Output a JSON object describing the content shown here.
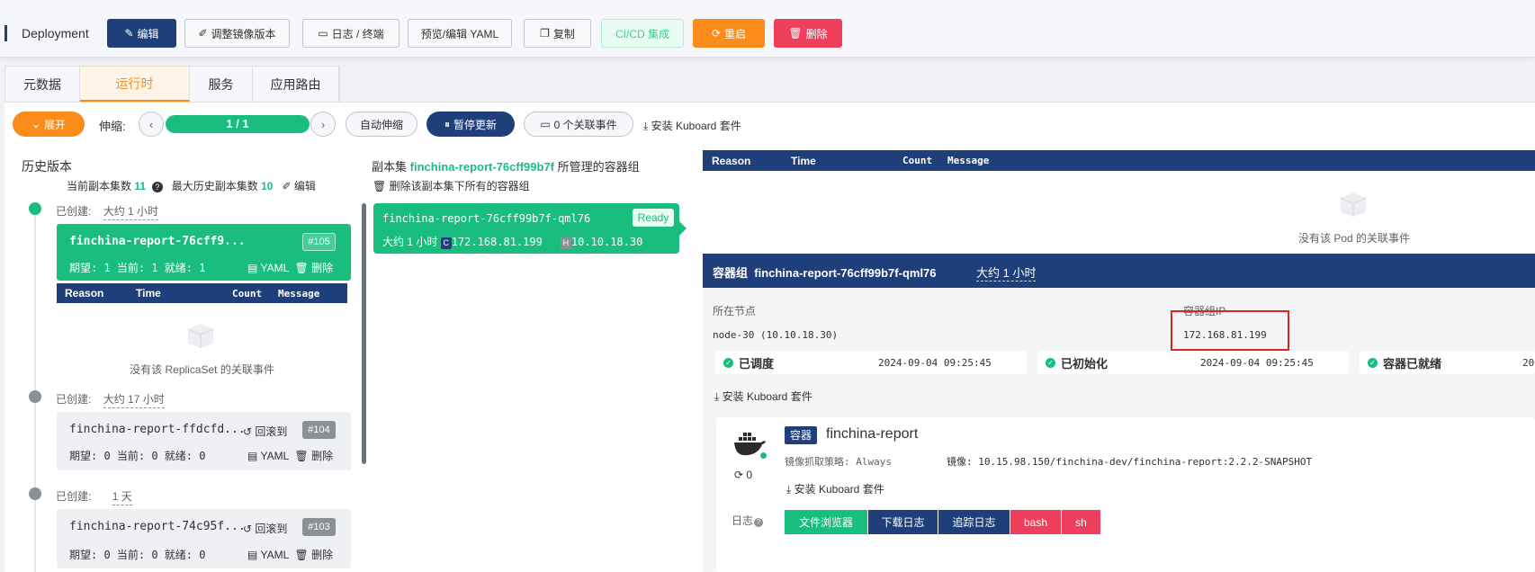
{
  "toolbar": {
    "kind": "Deployment",
    "buttons": {
      "edit": "编辑",
      "adjust_image": "调整镜像版本",
      "logs": "日志 / 终端",
      "yaml": "预览/编辑 YAML",
      "copy": "复制",
      "cicd": "CI/CD 集成",
      "restart": "重启",
      "delete": "删除"
    }
  },
  "tabs": [
    {
      "label": "元数据",
      "active": false
    },
    {
      "label": "运行时",
      "active": true
    },
    {
      "label": "服务",
      "active": false
    },
    {
      "label": "应用路由",
      "active": false
    }
  ],
  "controls": {
    "expand": "展开",
    "scale_label": "伸缩:",
    "scale_text": "1 / 1",
    "scale_fraction": 1.0,
    "autoscale": "自动伸缩",
    "pause_update": "暂停更新",
    "related_events": "0 个关联事件",
    "install_kuboard": "安装 Kuboard 套件"
  },
  "history": {
    "title": "历史版本",
    "current_label": "当前副本集数",
    "current_value": "11",
    "max_label": "最大历史副本集数",
    "max_value": "10",
    "edit": "编辑",
    "created_label": "已创建:",
    "no_events": "没有该 ReplicaSet 的关联事件",
    "rollback": "回滚到",
    "yaml": "YAML",
    "delete": "删除",
    "items": [
      {
        "age": "大约 1 小时",
        "name": "finchina-report-76cff9...",
        "rev": "#105",
        "stats": "期望: 1 当前: 1 就绪: 1",
        "active": true
      },
      {
        "age": "大约 17 小时",
        "name": "finchina-report-ffdcfd...",
        "rev": "#104",
        "stats": "期望: 0 当前: 0 就绪: 0",
        "active": false
      },
      {
        "age": "1 天",
        "name": "finchina-report-74c95f...",
        "rev": "#103",
        "stats": "期望: 0 当前: 0 就绪: 0",
        "active": false
      }
    ]
  },
  "events_table": {
    "reason": "Reason",
    "time": "Time",
    "count": "Count",
    "message": "Message"
  },
  "replicaset": {
    "prefix": "副本集",
    "name": "finchina-report-76cff99b7f",
    "suffix": "所管理的容器组",
    "delete_all": "删除该副本集下所有的容器组"
  },
  "pod_card": {
    "name": "finchina-report-76cff99b7f-qml76",
    "status": "Ready",
    "age": "大约 1 小时",
    "c_tag": "C",
    "pod_ip": "172.168.81.199",
    "h_tag": "H",
    "host_ip": "10.10.18.30"
  },
  "pod_events": {
    "no_events": "没有该 Pod 的关联事件"
  },
  "pod_detail": {
    "title_prefix": "容器组",
    "name": "finchina-report-76cff99b7f-qml76",
    "age": "大约 1 小时",
    "node_label": "所在节点",
    "node_value": "node-30 (10.10.18.30)",
    "ip_label": "容器组IP",
    "ip_value": "172.168.81.199",
    "conditions": [
      {
        "label": "已调度",
        "time": "2024-09-04 09:25:45"
      },
      {
        "label": "已初始化",
        "time": "2024-09-04 09:25:45"
      },
      {
        "label": "容器已就绪",
        "time": "20"
      }
    ],
    "install_kuboard": "安装 Kuboard 套件"
  },
  "container": {
    "tag": "容器",
    "name": "finchina-report",
    "pull_policy_label": "镜像抓取策略:",
    "pull_policy": "Always",
    "image_label": "镜像:",
    "image": "10.15.98.150/finchina-dev/finchina-report:2.2.2-SNAPSHOT",
    "restarts": "0",
    "install_kuboard": "安装 Kuboard 套件",
    "log_label": "日志",
    "log_buttons": {
      "file_browser": "文件浏览器",
      "download_logs": "下载日志",
      "follow_logs": "追踪日志",
      "bash": "bash",
      "sh": "sh"
    }
  },
  "colors": {
    "primary": "#1f3f7a",
    "success": "#19be7f",
    "warning": "#fb8c1b",
    "danger": "#ef3f5c",
    "highlight": "#e2231a"
  }
}
